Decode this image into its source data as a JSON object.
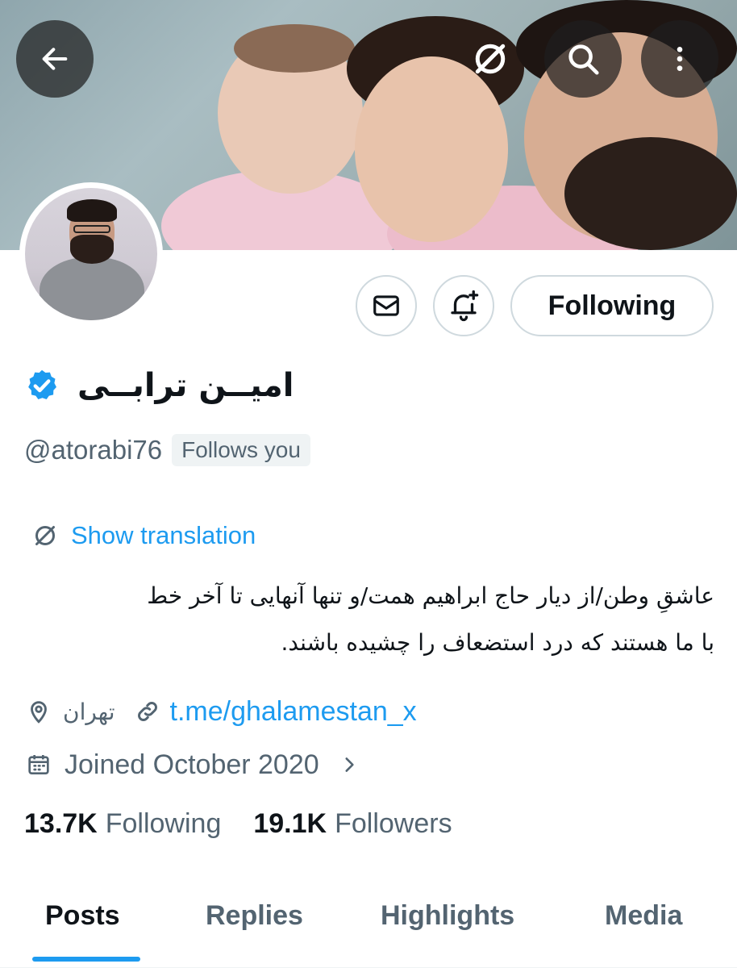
{
  "header": {
    "back_icon": "arrow-left-icon",
    "translate_icon": "translate-icon",
    "search_icon": "search-icon",
    "more_icon": "more-vertical-icon"
  },
  "profile": {
    "name": "امیــن ترابــی",
    "handle": "@atorabi76",
    "follows_you": "Follows you",
    "verified": true
  },
  "actions": {
    "message_icon": "mail-icon",
    "notify_icon": "bell-plus-icon",
    "follow_label": "Following"
  },
  "bio": {
    "translation_label": "Show translation",
    "line1": "عاشقِ وطن/از دیار حاج ابراهیم همت/و تنها آنهایی تا آخر خط",
    "line2": "با ما هستند که درد استضعاف را چشیده باشند."
  },
  "meta": {
    "location": "تهران",
    "link": "t.me/ghalamestan_x",
    "joined": "Joined October 2020"
  },
  "stats": {
    "following_count": "13.7K",
    "following_label": "Following",
    "followers_count": "19.1K",
    "followers_label": "Followers"
  },
  "tabs": [
    {
      "label": "Posts",
      "active": true
    },
    {
      "label": "Replies",
      "active": false
    },
    {
      "label": "Highlights",
      "active": false
    },
    {
      "label": "Media",
      "active": false
    }
  ],
  "colors": {
    "accent": "#1d9bf0",
    "text": "#0f1419",
    "secondary": "#536471"
  }
}
